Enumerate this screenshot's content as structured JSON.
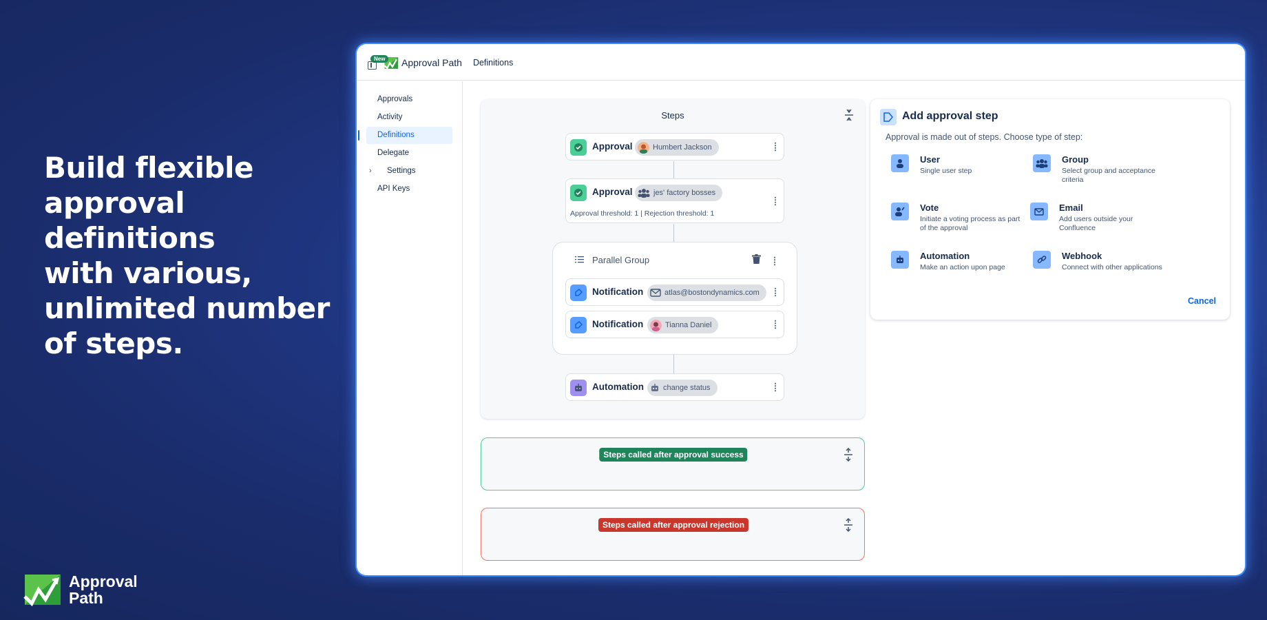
{
  "hero": {
    "line1": "Build flexible",
    "line2": "approval definitions",
    "line3": "with various,",
    "line4": "unlimited number",
    "line5": "of steps."
  },
  "brand": {
    "name_line1": "Approval",
    "name_line2": "Path"
  },
  "topbar": {
    "new_badge": "New",
    "app_title": "Approval Path",
    "breadcrumb": "Definitions"
  },
  "sidebar": {
    "items": [
      {
        "label": "Approvals"
      },
      {
        "label": "Activity"
      },
      {
        "label": "Definitions",
        "active": true
      },
      {
        "label": "Delegate"
      },
      {
        "label": "Settings",
        "expandable": true
      },
      {
        "label": "API Keys"
      }
    ]
  },
  "steps": {
    "title": "Steps",
    "step1": {
      "type": "Approval",
      "assignee": "Humbert Jackson"
    },
    "step2": {
      "type": "Approval",
      "assignee": "jes' factory bosses",
      "thresholds": "Approval threshold: 1 | Rejection threshold: 1"
    },
    "parallel": {
      "title": "Parallel Group",
      "item1": {
        "type": "Notification",
        "assignee": "atlas@bostondynamics.com"
      },
      "item2": {
        "type": "Notification",
        "assignee": "Tianna Daniel"
      }
    },
    "step3": {
      "type": "Automation",
      "action": "change status"
    }
  },
  "after": {
    "success_label": "Steps called after approval success",
    "reject_label": "Steps called after approval rejection"
  },
  "add_step": {
    "title": "Add approval step",
    "description": "Approval is made out of steps. Choose type of step:",
    "options": [
      {
        "name": "User",
        "desc": "Single user step",
        "icon": "user-icon"
      },
      {
        "name": "Group",
        "desc": "Select group and acceptance criteria",
        "icon": "group-icon"
      },
      {
        "name": "Vote",
        "desc": "Initiate a voting process as part of the approval",
        "icon": "vote-icon"
      },
      {
        "name": "Email",
        "desc": "Add users outside your Confluence",
        "icon": "email-icon"
      },
      {
        "name": "Automation",
        "desc": "Make an action upon page",
        "icon": "robot-icon"
      },
      {
        "name": "Webhook",
        "desc": "Connect with other applications",
        "icon": "link-icon"
      }
    ],
    "cancel_label": "Cancel"
  },
  "colors": {
    "background": "#1a2c6b",
    "accent": "#0c66e4",
    "success": "#1f845a",
    "danger": "#c9372c",
    "approval_icon": "#4bce97",
    "notification_icon": "#579dff",
    "automation_icon": "#9f8fef"
  }
}
